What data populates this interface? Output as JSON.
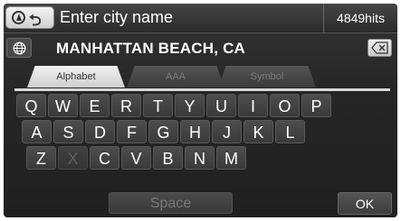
{
  "header": {
    "title": "Enter city name",
    "hits": "4849hits",
    "home_icon": "navigation-compass-icon",
    "back_icon": "back-arrow-icon"
  },
  "input": {
    "value": "MANHATTAN BEACH, CA",
    "globe_icon": "globe-icon",
    "delete_icon": "backspace-icon"
  },
  "tabs": [
    {
      "label": "Alphabet",
      "active": true
    },
    {
      "label": "AAA",
      "active": false
    },
    {
      "label": "Symbol",
      "active": false
    }
  ],
  "keyboard": {
    "row1": [
      {
        "label": "Q",
        "enabled": true
      },
      {
        "label": "W",
        "enabled": true
      },
      {
        "label": "E",
        "enabled": true
      },
      {
        "label": "R",
        "enabled": true
      },
      {
        "label": "T",
        "enabled": true
      },
      {
        "label": "Y",
        "enabled": true
      },
      {
        "label": "U",
        "enabled": true
      },
      {
        "label": "I",
        "enabled": true
      },
      {
        "label": "O",
        "enabled": true
      },
      {
        "label": "P",
        "enabled": true
      }
    ],
    "row2": [
      {
        "label": "A",
        "enabled": true
      },
      {
        "label": "S",
        "enabled": true
      },
      {
        "label": "D",
        "enabled": true
      },
      {
        "label": "F",
        "enabled": true
      },
      {
        "label": "G",
        "enabled": true
      },
      {
        "label": "H",
        "enabled": true
      },
      {
        "label": "J",
        "enabled": true
      },
      {
        "label": "K",
        "enabled": true
      },
      {
        "label": "L",
        "enabled": true
      }
    ],
    "row3": [
      {
        "label": "Z",
        "enabled": true
      },
      {
        "label": "X",
        "enabled": false
      },
      {
        "label": "C",
        "enabled": true
      },
      {
        "label": "V",
        "enabled": true
      },
      {
        "label": "B",
        "enabled": true
      },
      {
        "label": "N",
        "enabled": true
      },
      {
        "label": "M",
        "enabled": true
      }
    ]
  },
  "footer": {
    "space_label": "Space",
    "ok_label": "OK"
  }
}
